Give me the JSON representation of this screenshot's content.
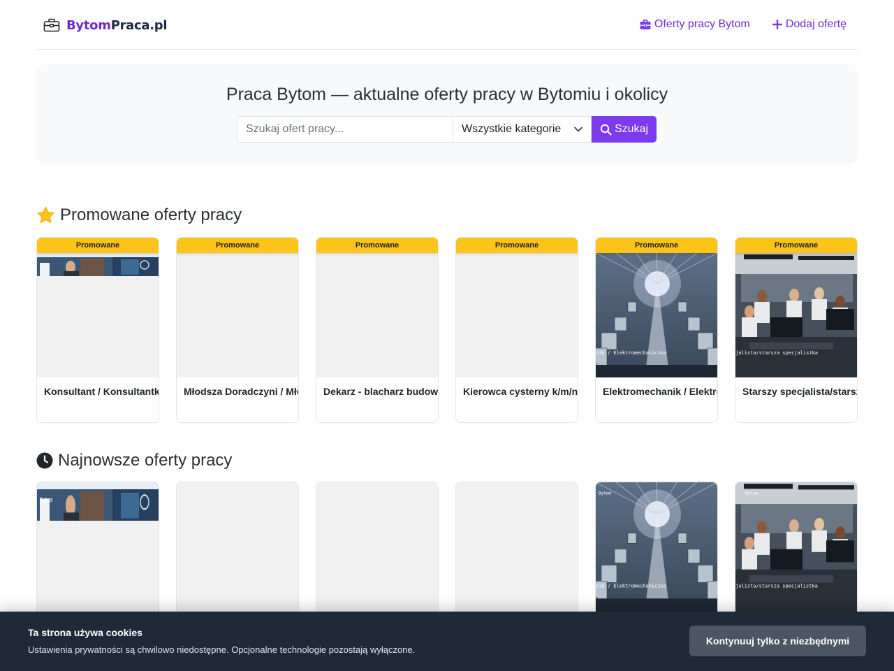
{
  "header": {
    "logo_part1": "Bytom",
    "logo_part2": "Praca.pl",
    "nav": [
      {
        "label": "Oferty pracy Bytom",
        "icon": "briefcase-icon"
      },
      {
        "label": "Dodaj ofertę",
        "icon": "plus-icon"
      }
    ]
  },
  "hero": {
    "title": "Praca Bytom — aktualne oferty pracy w Bytomiu i okolicy",
    "search_placeholder": "Szukaj ofert pracy...",
    "category_selected": "Wszystkie kategorie",
    "search_button": "Szukaj"
  },
  "promoted": {
    "title": "Promowane oferty pracy",
    "icon": "star-icon",
    "badge": "Promowane",
    "cards": [
      {
        "title": "Konsultant / Konsultantka",
        "image": "office-photo",
        "image_caption": ""
      },
      {
        "title": "Młodsza Doradczyni / Młodszy Doradca",
        "image": "none",
        "image_caption": ""
      },
      {
        "title": "Dekarz - blacharz budowlany",
        "image": "none",
        "image_caption": ""
      },
      {
        "title": "Kierowca cysterny k/m/n",
        "image": "none",
        "image_caption": ""
      },
      {
        "title": "Elektromechanik / Elektromechaniczka",
        "image": "factory-photo",
        "image_caption": "nik / Elektromechaniczka"
      },
      {
        "title": "Starszy specjalista/starsza specjalistka",
        "image": "computers-photo",
        "image_caption": "jalista/starsza specjalistka"
      }
    ]
  },
  "newest": {
    "title": "Najnowsze oferty pracy",
    "icon": "clock-icon",
    "cards": [
      {
        "image": "office-photo",
        "image_tag": "Bytom",
        "image_caption": ""
      },
      {
        "image": "none",
        "image_tag": "",
        "image_caption": ""
      },
      {
        "image": "none",
        "image_tag": "",
        "image_caption": ""
      },
      {
        "image": "none",
        "image_tag": "",
        "image_caption": ""
      },
      {
        "image": "factory-photo",
        "image_tag": "Bytom",
        "image_caption": "nik / Elektromechaniczka"
      },
      {
        "image": "computers-photo",
        "image_tag": "Bytom",
        "image_caption": "jalista/starsza specjalistka"
      }
    ]
  },
  "cookie": {
    "title": "Ta strona używa cookies",
    "text": "Ustawienia prywatności są chwilowo niedostępne. Opcjonalne technologie pozostają wyłączone.",
    "button": "Kontynuuj tylko z niezbędnymi"
  },
  "colors": {
    "accent": "#7c3aed",
    "badge": "#fcc419",
    "cookie_bg": "#1f2937"
  }
}
